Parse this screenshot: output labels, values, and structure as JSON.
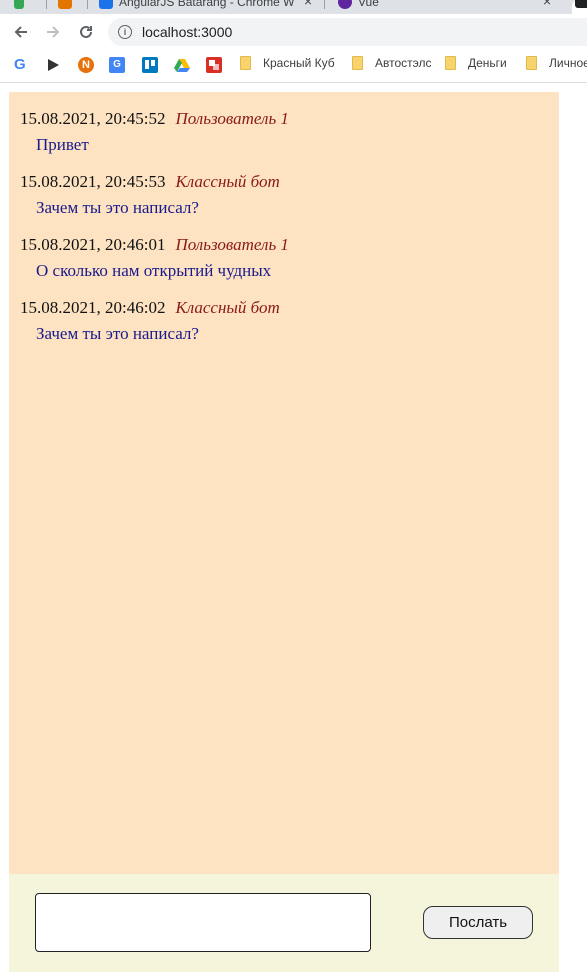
{
  "browser": {
    "tabs": [
      {
        "title": "",
        "favicon_color": "#e37400"
      },
      {
        "title": "AngularJS Batarang - Chrome W",
        "favicon_color": "#1a73e8"
      },
      {
        "title": "Vue",
        "favicon_color": "#5f259f"
      }
    ],
    "url": "localhost:3000",
    "bookmarks": {
      "icons": [
        "google-icon",
        "play-icon",
        "n-icon",
        "translate-icon",
        "trello-icon",
        "drive-icon",
        "red-app-icon"
      ],
      "folders": [
        "Красный Куб",
        "Автостэлс",
        "Деньги",
        "Личное"
      ]
    }
  },
  "messages": [
    {
      "time": "15.08.2021, 20:45:52",
      "author": "Пользователь 1",
      "text": "Привет"
    },
    {
      "time": "15.08.2021, 20:45:53",
      "author": "Классный бот",
      "text": "Зачем ты это написал?"
    },
    {
      "time": "15.08.2021, 20:46:01",
      "author": "Пользователь 1",
      "text": "О сколько нам открытий чудных"
    },
    {
      "time": "15.08.2021, 20:46:02",
      "author": "Классный бот",
      "text": "Зачем ты это написал?"
    }
  ],
  "composer": {
    "input_value": "",
    "send_label": "Послать"
  },
  "colors": {
    "chat_bg": "#fde3c2",
    "composer_bg": "#f5f5dc",
    "author": "#8b1a12",
    "message_text": "#1a1a8c"
  }
}
